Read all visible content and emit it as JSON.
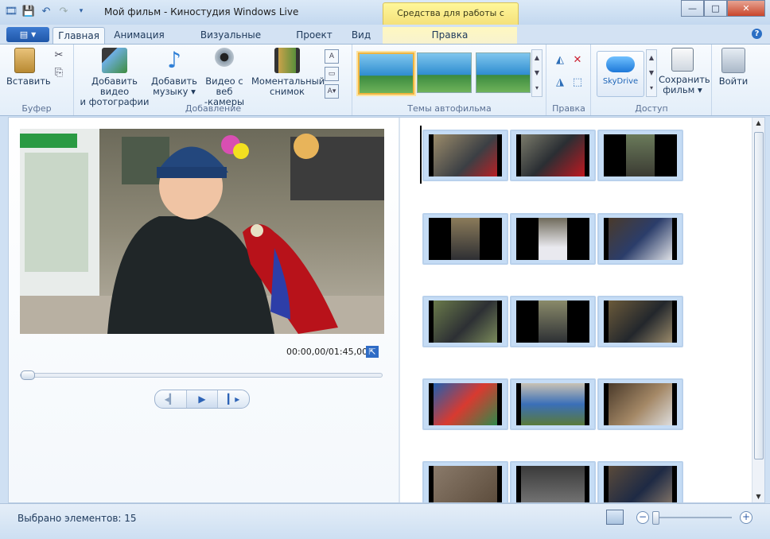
{
  "titlebar": {
    "title": "Мой фильм - Киностудия Windows Live",
    "context_tab": "Средства для работы с видео",
    "quick_access": [
      "app-icon",
      "save-icon",
      "undo-icon",
      "redo-icon",
      "customize-icon"
    ],
    "buttons": {
      "minimize": "—",
      "maximize": "□",
      "close": "✕"
    }
  },
  "tabs": {
    "app_menu_icon": "▤",
    "items": [
      "Главная",
      "Анимация",
      "Визуальные эффекты",
      "Проект",
      "Вид",
      "Правка"
    ],
    "active": "Главная",
    "help": "?"
  },
  "ribbon": {
    "clipboard": {
      "paste_label": "Вставить",
      "group_label": "Буфер"
    },
    "add": {
      "add_video_label_1": "Добавить видео",
      "add_video_label_2": "и фотографии",
      "add_music_label_1": "Добавить",
      "add_music_label_2": "музыку ▾",
      "webcam_label_1": "Видео с веб",
      "webcam_label_2": "-камеры",
      "snapshot_label_1": "Моментальный",
      "snapshot_label_2": "снимок",
      "group_label": "Добавление"
    },
    "themes": {
      "group_label": "Темы автофильма"
    },
    "edit": {
      "group_label": "Правка"
    },
    "share": {
      "skydrive_label": "SkyDrive",
      "save_movie_label_1": "Сохранить",
      "save_movie_label_2": "фильм ▾",
      "group_label": "Доступ"
    },
    "signin": {
      "label": "Войти"
    }
  },
  "preview": {
    "timecode": "00:00,00/01:45,00",
    "seek_position": 0.0
  },
  "storyboard": {
    "clip_count": 15
  },
  "statusbar": {
    "selected_text": "Выбрано элементов: 15",
    "zoom_out": "−",
    "zoom_in": "+"
  },
  "colors": {
    "accent": "#2b6fc4",
    "context_tab": "#f4e07a",
    "selection_border": "#f0b540"
  }
}
